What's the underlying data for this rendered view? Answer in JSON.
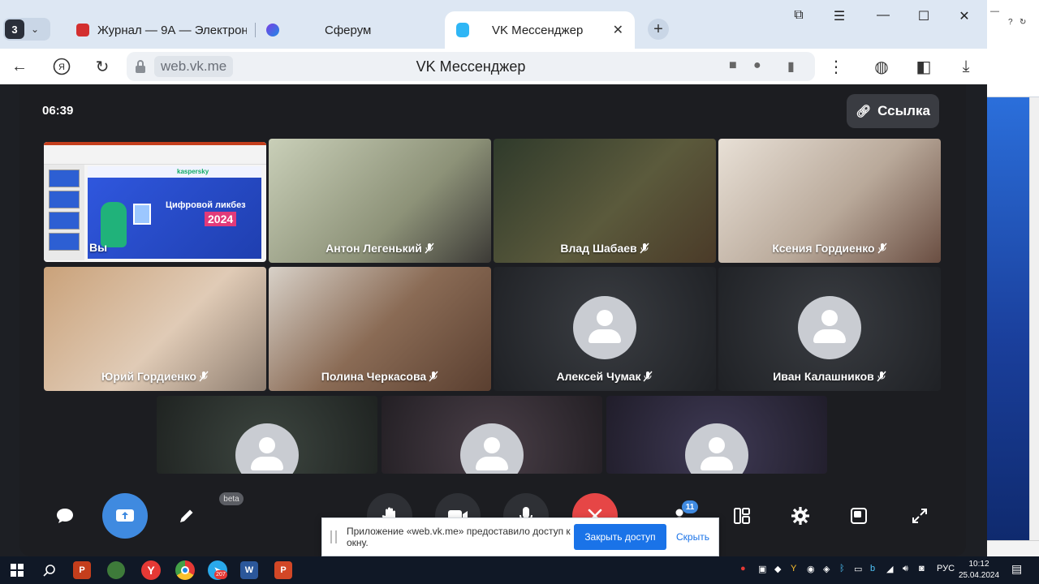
{
  "browser": {
    "tab_count": "3",
    "tabs": [
      {
        "title": "Журнал — 9А — Электрон"
      },
      {
        "title": "Сферум"
      },
      {
        "title": "VK Мессенджер"
      }
    ],
    "url_host": "web.vk.me",
    "page_title": "VK Мессенджер"
  },
  "call": {
    "timer": "06:39",
    "link_label": "Ссылка",
    "participants": [
      {
        "name": "Вы"
      },
      {
        "name": "Антон Легенький"
      },
      {
        "name": "Влад Шабаев"
      },
      {
        "name": "Ксения Гордиенко"
      },
      {
        "name": "Юрий Гордиенко"
      },
      {
        "name": "Полина Черкасова"
      },
      {
        "name": "Алексей Чумак"
      },
      {
        "name": "Иван Калашников"
      }
    ],
    "slide": {
      "brand": "kaspersky",
      "title": "Цифровой ликбез",
      "year": "2024"
    },
    "beta_label": "beta",
    "participants_badge": "11"
  },
  "share_notice": {
    "message": "Приложение «web.vk.me» предоставило доступ к окну.",
    "stop_label": "Закрыть доступ",
    "hide_label": "Скрыть"
  },
  "taskbar": {
    "telegram_badge": "207",
    "lang": "РУС",
    "time": "10:12",
    "date": "25.04.2024"
  },
  "colors": {
    "call_bg": "#1c1d21",
    "accent_blue": "#3f8ae0",
    "end_red": "#e64646",
    "tab_bar": "#dde7f3"
  }
}
